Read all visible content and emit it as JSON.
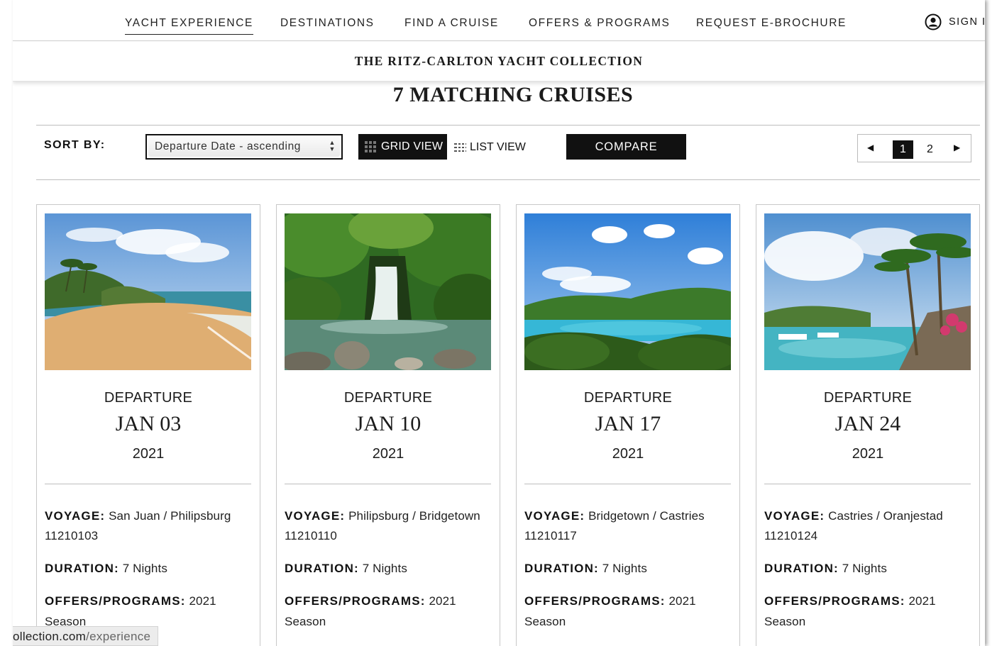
{
  "nav": {
    "items": [
      "YACHT EXPERIENCE",
      "DESTINATIONS",
      "FIND A CRUISE",
      "OFFERS & PROGRAMS",
      "REQUEST E-BROCHURE"
    ],
    "signin": "SIGN I"
  },
  "brand": "THE RITZ-CARLTON YACHT COLLECTION",
  "heading": "7 MATCHING CRUISES",
  "toolbar": {
    "sort_label": "SORT BY:",
    "sort_value": "Departure Date - ascending",
    "grid_view": "GRID VIEW",
    "list_view": "LIST VIEW",
    "compare": "COMPARE",
    "pages": [
      "1",
      "2"
    ],
    "current_page": "1"
  },
  "cards": [
    {
      "departure_label": "DEPARTURE",
      "date": "JAN 03",
      "year": "2021",
      "voyage_label": "VOYAGE:",
      "voyage": "San Juan / Philipsburg",
      "code": "11210103",
      "duration_label": "DURATION:",
      "duration": "7 Nights",
      "offers_label": "OFFERS/PROGRAMS:",
      "offers": "2021",
      "offers_line2": "Season",
      "photo": "beach-icon"
    },
    {
      "departure_label": "DEPARTURE",
      "date": "JAN 10",
      "year": "2021",
      "voyage_label": "VOYAGE:",
      "voyage": "Philipsburg / Bridgetown",
      "code": "11210110",
      "duration_label": "DURATION:",
      "duration": "7 Nights",
      "offers_label": "OFFERS/PROGRAMS:",
      "offers": "2021",
      "offers_line2": "Season",
      "photo": "waterfall-icon"
    },
    {
      "departure_label": "DEPARTURE",
      "date": "JAN 17",
      "year": "2021",
      "voyage_label": "VOYAGE:",
      "voyage": "Bridgetown / Castries",
      "code": "11210117",
      "duration_label": "DURATION:",
      "duration": "7 Nights",
      "offers_label": "OFFERS/PROGRAMS:",
      "offers": "2021",
      "offers_line2": "Season",
      "photo": "bay-icon"
    },
    {
      "departure_label": "DEPARTURE",
      "date": "JAN 24",
      "year": "2021",
      "voyage_label": "VOYAGE:",
      "voyage": "Castries / Oranjestad",
      "code": "11210124",
      "duration_label": "DURATION:",
      "duration": "7 Nights",
      "offers_label": "OFFERS/PROGRAMS:",
      "offers": "2021",
      "offers_line2": "Season",
      "photo": "harbor-icon"
    }
  ],
  "status_url": {
    "host": "ollection.com",
    "path": "/experience"
  },
  "colors": {
    "primary": "#111111",
    "rule": "#bdbdbd",
    "text": "#222222"
  }
}
